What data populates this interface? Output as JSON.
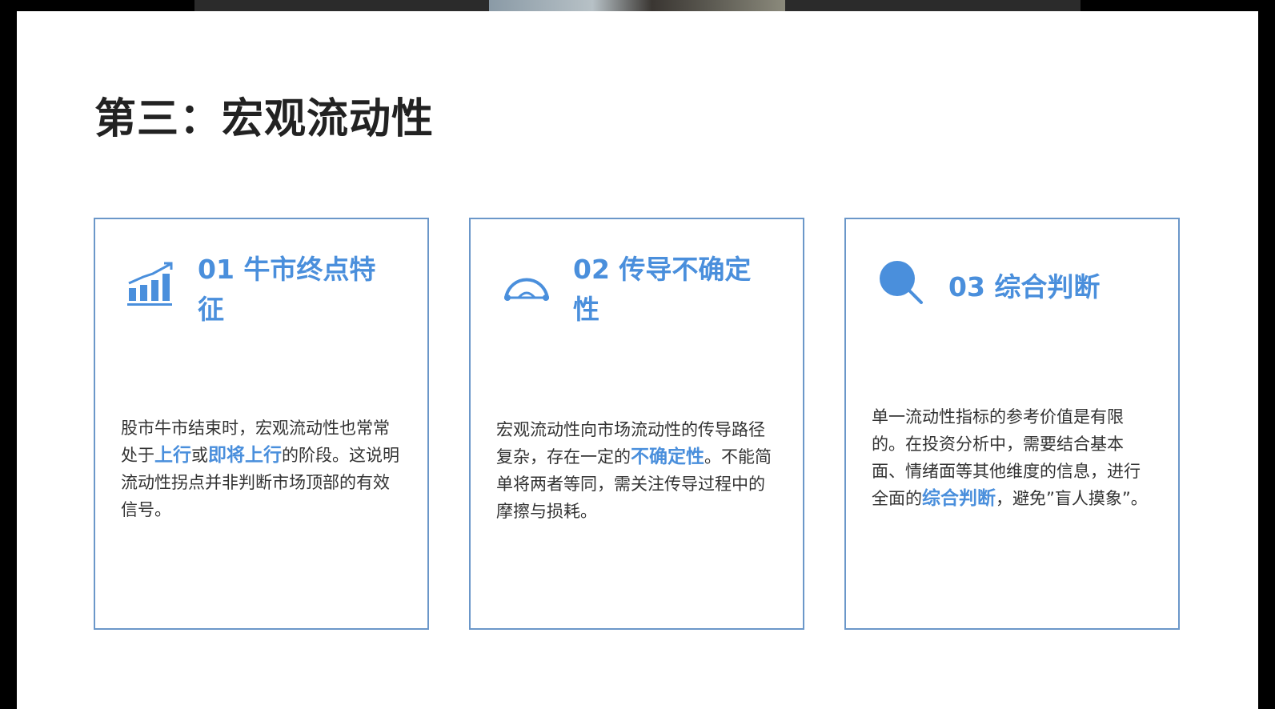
{
  "slide": {
    "title": "第三：宏观流动性"
  },
  "cards": [
    {
      "icon": "bar-chart-growth-icon",
      "heading": "01 牛市终点特征",
      "body": {
        "t1": "股市牛市结束时，宏观流动性也常常处于",
        "h1": "上行",
        "t2": "或",
        "h2": "即将上行",
        "t3": "的阶段。这说明流动性拐点并非判断市场顶部的有效信号。"
      }
    },
    {
      "icon": "bridge-path-icon",
      "heading": "02 传导不确定性",
      "body": {
        "t1": "宏观流动性向市场流动性的传导路径复杂，存在一定的",
        "h1": "不确定性",
        "t2": "。不能简单将两者等同，需关注传导过程中的摩擦与损耗。"
      }
    },
    {
      "icon": "magnifier-icon",
      "heading": "03 综合判断",
      "body": {
        "t1": "单一流动性指标的参考价值是有限的。在投资分析中，需要结合基本面、情绪面等其他维度的信息，进行全面的",
        "h1": "综合判断",
        "t2": "，避免”盲人摸象”。"
      }
    }
  ],
  "colors": {
    "accent": "#4a8fdc",
    "border": "#6b97c9",
    "title": "#222222",
    "text": "#333333"
  }
}
